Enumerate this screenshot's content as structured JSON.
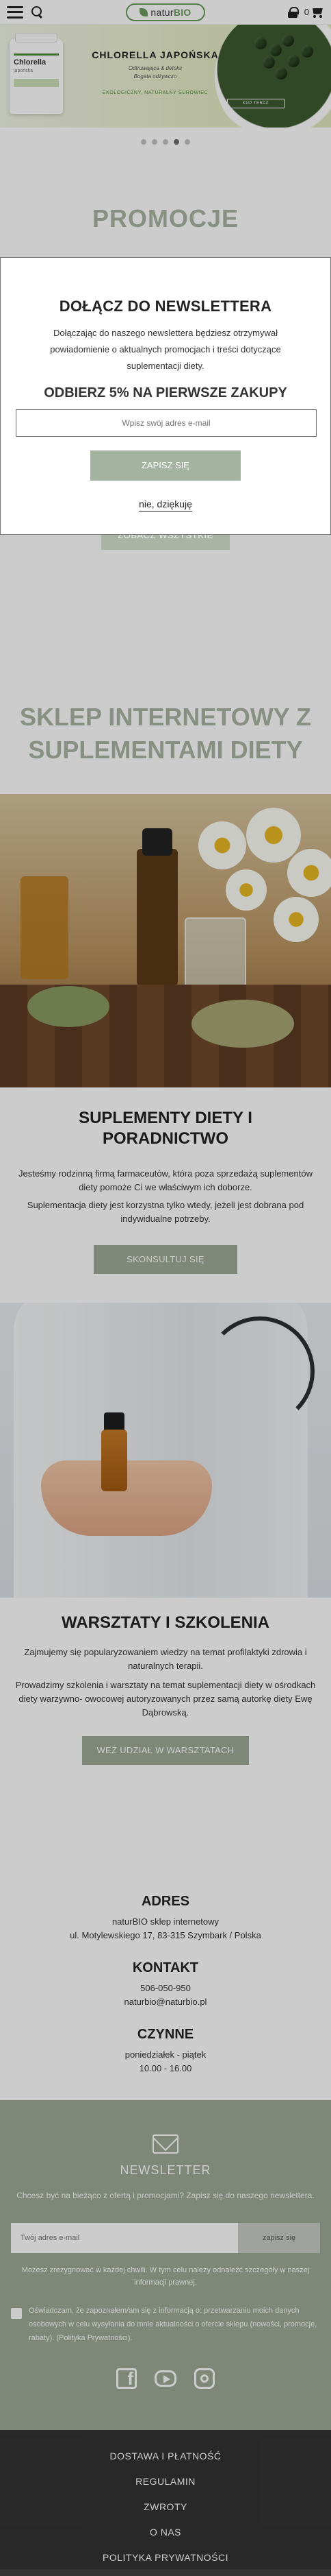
{
  "header": {
    "logo_text_left": "natur",
    "logo_text_right": "BIO",
    "cart_count": "0"
  },
  "banner": {
    "bottle_label": "Chlorella",
    "bottle_sub": "japońska",
    "title": "CHLORELLA JAPOŃSKA",
    "subtitle_line1": "Odtruwająca & detoks",
    "subtitle_line2": "Bogata odżywczo",
    "tagline": "EKOLOGICZNY, NATURALNY SUROWIEC",
    "button": "KUP TERAZ",
    "slides": 5,
    "active_slide": 4
  },
  "promocje": {
    "title": "PROMOCJE",
    "see_all": "ZOBACZ WSZYSTKIE"
  },
  "sklep": {
    "title": "SKLEP INTERNETOWY Z SUPLEMENTAMI DIETY"
  },
  "suplementy": {
    "title": "SUPLEMENTY DIETY I PORADNICTWO",
    "text1": "Jesteśmy rodzinną firmą farmaceutów, która poza sprzedażą suplementów diety pomoże Ci we właściwym ich doborze.",
    "text2": "Suplementacja diety jest korzystna tylko wtedy, jeżeli jest dobrana pod indywidualne potrzeby.",
    "button": "SKONSULTUJ SIĘ"
  },
  "warsztaty": {
    "title": "WARSZTATY I SZKOLENIA",
    "text1": "Zajmujemy się popularyzowaniem wiedzy na temat profilaktyki zdrowia i naturalnych terapii.",
    "text2": "Prowadzimy szkolenia i warsztaty na temat suplementacji diety w ośrodkach diety warzywno- owocowej autoryzowanych przez samą autorkę diety Ewę Dąbrowską.",
    "button": "WEŹ UDZIAŁ W WARSZTATACH"
  },
  "contact": {
    "address_title": "ADRES",
    "address_line1": "naturBIO sklep internetowy",
    "address_line2": "ul. Motylewskiego 17, 83-315 Szymbark / Polska",
    "contact_title": "KONTAKT",
    "phone": "506-050-950",
    "email": "naturbio@naturbio.pl",
    "hours_title": "CZYNNE",
    "days": "poniedziałek - piątek",
    "hours": "10.00 - 16.00"
  },
  "newsletter_footer": {
    "title": "NEWSLETTER",
    "text": "Chcesz być na bieżąco z ofertą i promocjami? Zapisz się do naszego newslettera.",
    "input_placeholder": "Twój adres e-mail",
    "submit": "zapisz się",
    "note": "Możesz zrezygnować w każdej chwili. W tym celu należy odnaleźć szczegóły w naszej informacji prawnej.",
    "consent": "Oświadczam, że zapoznałem/am się z informacją o: przetwarzaniu moich danych osobowych w celu wysyłania do mnie aktualności o ofercie sklepu (nowości, promocje, rabaty). (Polityka Prywatności)."
  },
  "bottom_nav": {
    "items": [
      "DOSTAWA I PŁATNOŚĆ",
      "REGULAMIN",
      "ZWROTY",
      "O NAS",
      "POLITYKA PRYWATNOŚCI"
    ]
  },
  "modal": {
    "title": "DOŁĄCZ DO NEWSLETTERA",
    "text": "Dołączając do naszego newslettera będziesz otrzymywał powiadomienie o aktualnych promocjach i treści dotyczące suplementacji diety.",
    "offer": "ODBIERZ 5% NA PIERWSZE ZAKUPY",
    "input_placeholder": "Wpisz swój adres e-mail",
    "submit": "ZAPISZ SIĘ",
    "decline": "nie, dziękuję"
  },
  "colors": {
    "accent": "#9fab97",
    "logo_green": "#6b9b5a",
    "footer_dark": "#333333"
  }
}
